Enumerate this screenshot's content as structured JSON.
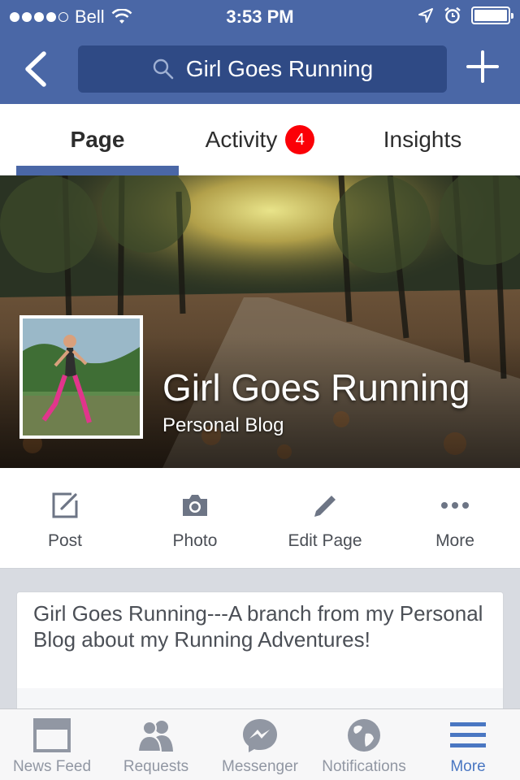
{
  "status_bar": {
    "carrier": "Bell",
    "time": "3:53 PM"
  },
  "nav": {
    "search_text": "Girl Goes Running",
    "icons": [
      "back-chevron-icon",
      "search-icon",
      "plus-icon"
    ]
  },
  "tabs": {
    "page": "Page",
    "activity": "Activity",
    "activity_badge": "4",
    "insights": "Insights",
    "active": "Page"
  },
  "header": {
    "page_name": "Girl Goes Running",
    "category": "Personal Blog"
  },
  "actions": {
    "post": "Post",
    "photo": "Photo",
    "edit_page": "Edit Page",
    "more": "More"
  },
  "about": {
    "description": "Girl Goes Running---A branch from my Personal Blog about my Running Adventures!"
  },
  "tabbar": {
    "news_feed": "News Feed",
    "requests": "Requests",
    "messenger": "Messenger",
    "notifications": "Notifications",
    "more": "More",
    "active": "More"
  },
  "colors": {
    "brand_blue": "#4a67a6",
    "search_bg": "#2f4a85",
    "badge_red": "#fb0007",
    "active_tab_blue": "#4a77c2",
    "inactive_gray": "#9197a3"
  }
}
